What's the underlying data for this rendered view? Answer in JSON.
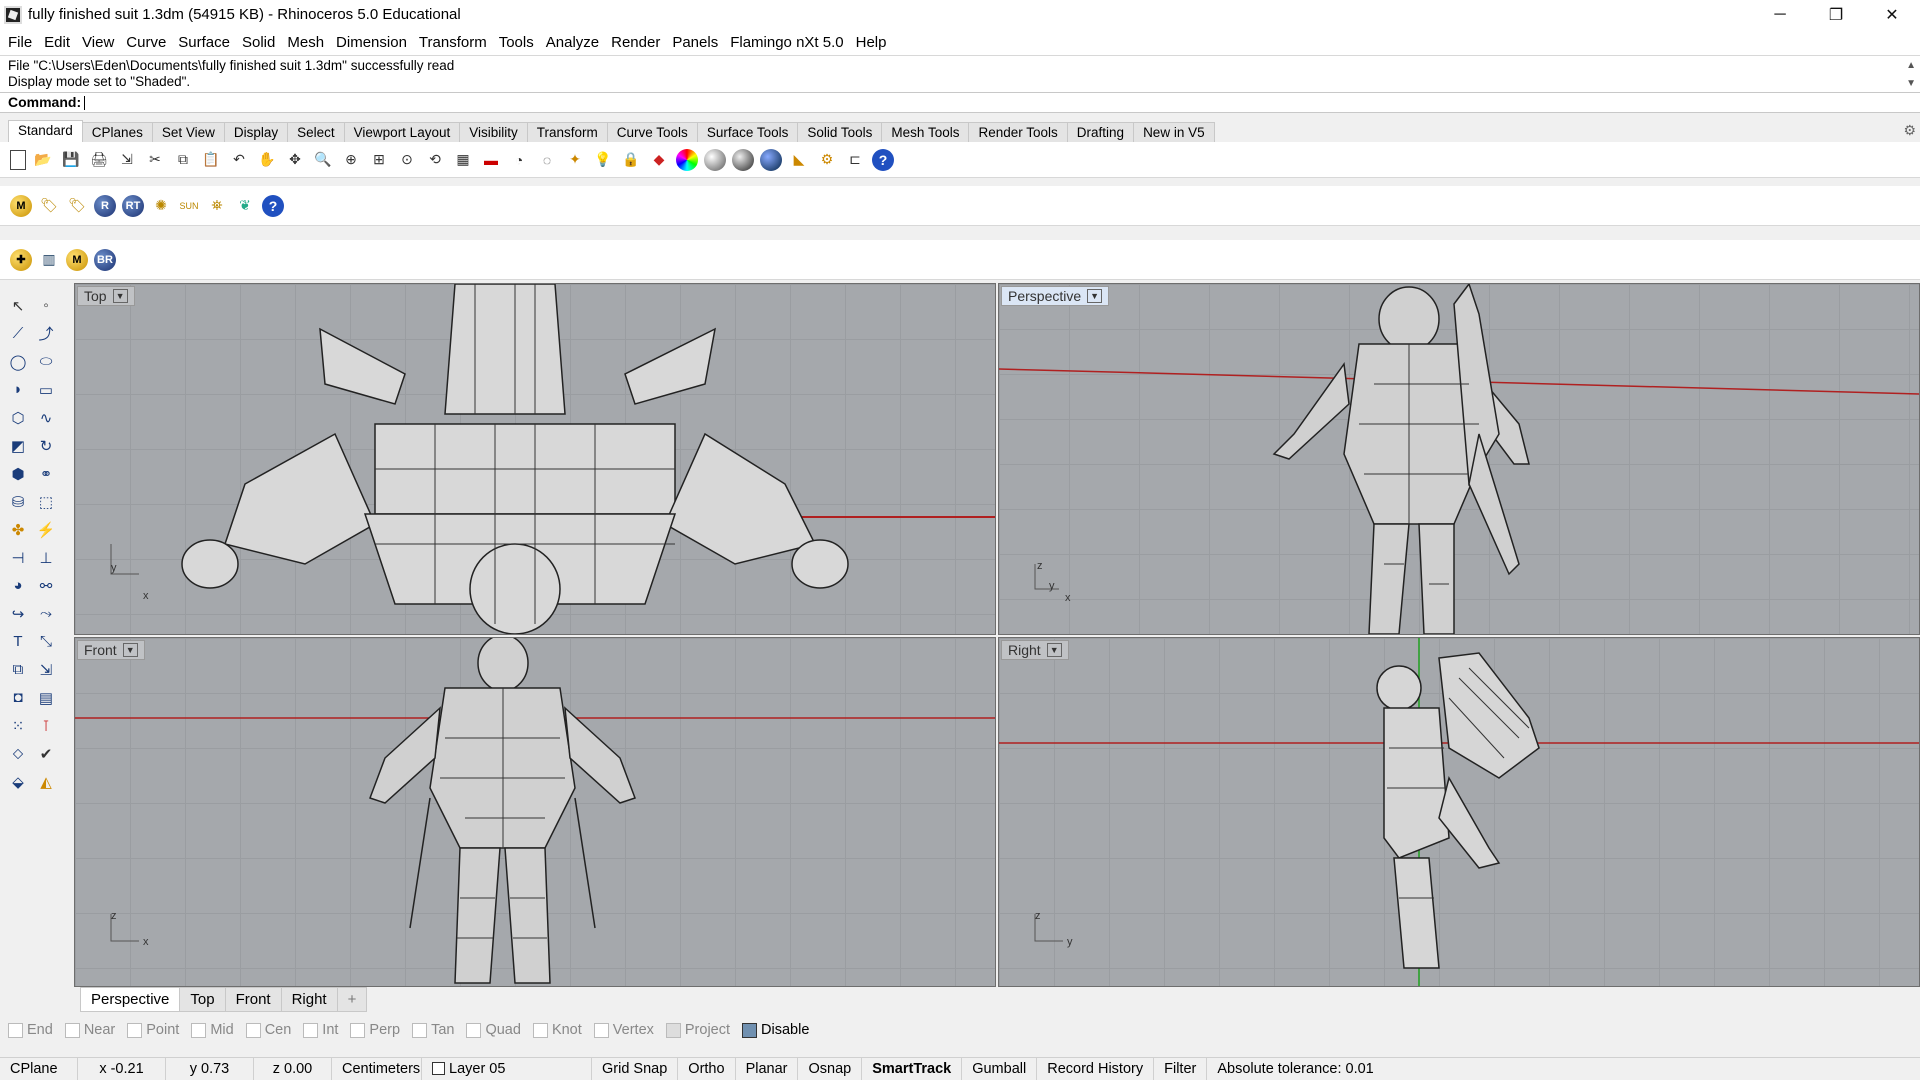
{
  "window": {
    "title": "fully finished suit 1.3dm (54915 KB) - Rhinoceros 5.0 Educational",
    "minimize": "─",
    "restore": "❐",
    "close": "✕"
  },
  "menu": [
    "File",
    "Edit",
    "View",
    "Curve",
    "Surface",
    "Solid",
    "Mesh",
    "Dimension",
    "Transform",
    "Tools",
    "Analyze",
    "Render",
    "Panels",
    "Flamingo nXt 5.0",
    "Help"
  ],
  "history": {
    "line1": "File \"C:\\Users\\Eden\\Documents\\fully finished suit 1.3dm\" successfully read",
    "line2": "Display mode set to \"Shaded\"."
  },
  "command": {
    "label": "Command:"
  },
  "toolbar_tabs": [
    "Standard",
    "CPlanes",
    "Set View",
    "Display",
    "Select",
    "Viewport Layout",
    "Visibility",
    "Transform",
    "Curve Tools",
    "Surface Tools",
    "Solid Tools",
    "Mesh Tools",
    "Render Tools",
    "Drafting",
    "New in V5"
  ],
  "active_toolbar_tab": "Standard",
  "toolbar2_labels": {
    "m": "M",
    "r": "R",
    "rt": "RT",
    "sun": "SUN"
  },
  "toolbar3_labels": {
    "br": "BR"
  },
  "viewports": {
    "top": {
      "label": "Top",
      "axis_a": "y",
      "axis_b": "x"
    },
    "perspective": {
      "label": "Perspective",
      "axis_a": "z",
      "axis_b": "y",
      "axis_c": "x"
    },
    "front": {
      "label": "Front",
      "axis_a": "z",
      "axis_b": "x"
    },
    "right": {
      "label": "Right",
      "axis_a": "z",
      "axis_b": "y"
    }
  },
  "viewport_tabs": [
    "Perspective",
    "Top",
    "Front",
    "Right"
  ],
  "viewport_tab_add": "+",
  "osnap": {
    "end": "End",
    "near": "Near",
    "point": "Point",
    "mid": "Mid",
    "cen": "Cen",
    "int": "Int",
    "perp": "Perp",
    "tan": "Tan",
    "quad": "Quad",
    "knot": "Knot",
    "vertex": "Vertex",
    "project": "Project",
    "disable": "Disable"
  },
  "status": {
    "cplane": "CPlane",
    "x": "x -0.21",
    "y": "y 0.73",
    "z": "z 0.00",
    "units": "Centimeters",
    "layer": "Layer 05",
    "grid_snap": "Grid Snap",
    "ortho": "Ortho",
    "planar": "Planar",
    "osnap": "Osnap",
    "smarttrack": "SmartTrack",
    "gumball": "Gumball",
    "record_history": "Record History",
    "filter": "Filter",
    "tolerance": "Absolute tolerance: 0.01"
  }
}
